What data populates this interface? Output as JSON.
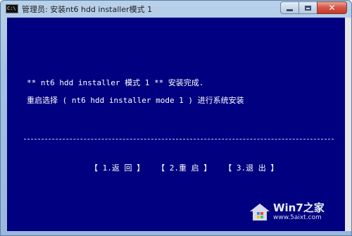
{
  "window": {
    "icon_text": "C:\\",
    "title": "管理员:  安装nt6 hdd installer模式 1"
  },
  "console": {
    "line1": "** nt6 hdd installer 模式 1 ** 安装完成.",
    "line2": "重启选择 ( nt6 hdd installer mode 1 ) 进行系统安装",
    "menu": {
      "back": "【 1.返 回 】",
      "reboot": "【 2.重 启 】",
      "exit": "【 3.退 出 】"
    }
  },
  "watermark": {
    "brand": "Win7之家",
    "url": "www.5aixt.com"
  },
  "colors": {
    "console_bg": "#000080",
    "console_text": "#ffffff",
    "title_bar": "#a3c1e3",
    "close_button": "#c13a29"
  }
}
